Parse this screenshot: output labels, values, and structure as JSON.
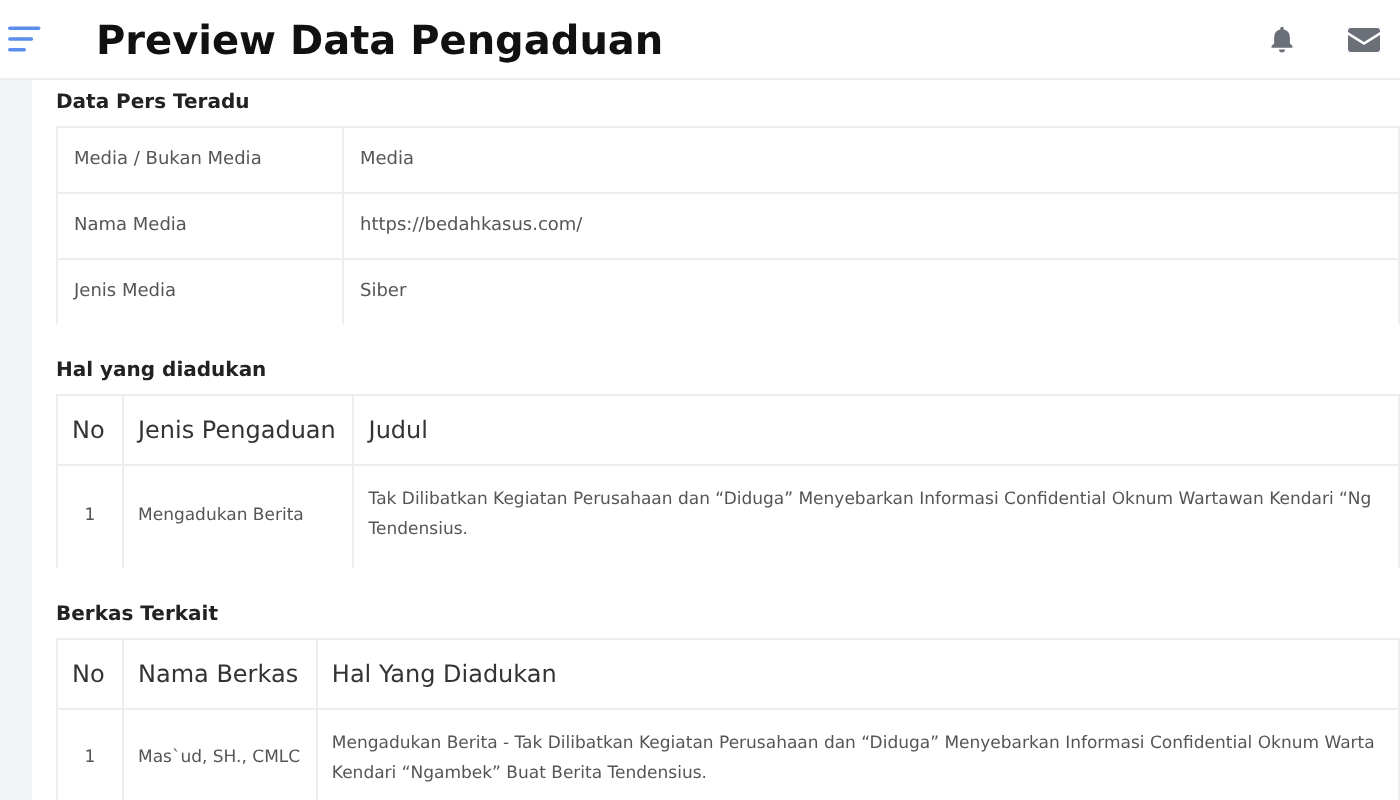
{
  "header": {
    "title": "Preview Data Pengaduan"
  },
  "pers": {
    "title": "Data Pers Teradu",
    "rows": [
      {
        "label": "Media / Bukan Media",
        "value": "Media"
      },
      {
        "label": "Nama Media",
        "value": "https://bedahkasus.com/"
      },
      {
        "label": "Jenis Media",
        "value": "Siber"
      }
    ]
  },
  "hal": {
    "title": "Hal yang diadukan",
    "columns": [
      "No",
      "Jenis Pengaduan",
      "Judul"
    ],
    "rows": [
      [
        "1",
        "Mengadukan Berita",
        "Tak Dilibatkan Kegiatan Perusahaan dan “Diduga” Menyebarkan Informasi Confidential Oknum Wartawan Kendari “Ng\nTendensius."
      ]
    ]
  },
  "berkas": {
    "title": "Berkas Terkait",
    "columns": [
      "No",
      "Nama Berkas",
      "Hal Yang Diadukan"
    ],
    "rows": [
      [
        "1",
        "Mas`ud, SH., CMLC",
        "Mengadukan Berita - Tak Dilibatkan Kegiatan Perusahaan dan “Diduga” Menyebarkan Informasi Confidential Oknum Warta\nKendari “Ngambek” Buat Berita Tendensius."
      ]
    ]
  }
}
